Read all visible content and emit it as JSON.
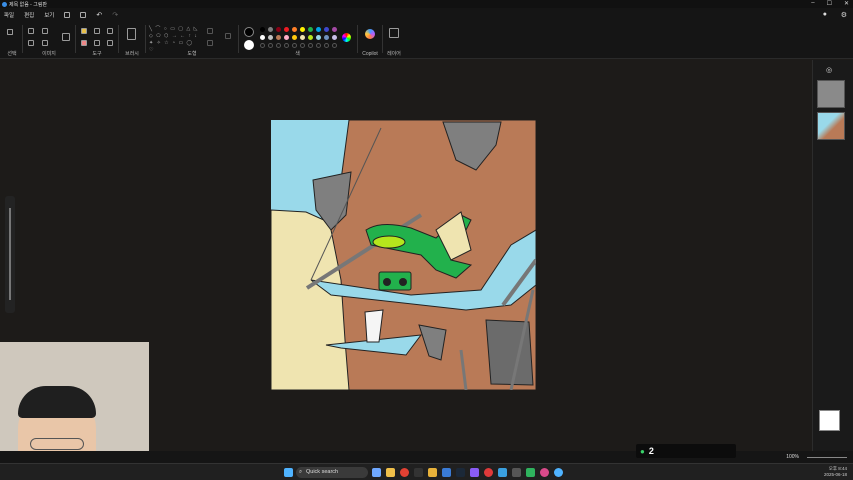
{
  "window": {
    "title": "제목 없음 - 그림판"
  },
  "menu": {
    "items": [
      "파일",
      "편집",
      "보기"
    ]
  },
  "ribbon": {
    "groups": {
      "selection": "선택",
      "image": "이미지",
      "tools": "도구",
      "brushes": "브러시",
      "shapes": "도형",
      "colors": "색",
      "copilot": "Copilot",
      "layers": "레이어"
    },
    "palette": [
      "#000000",
      "#7f7f7f",
      "#880015",
      "#ed1c24",
      "#ff7f27",
      "#fff200",
      "#22b14c",
      "#00a2e8",
      "#3f48cc",
      "#a349a4",
      "#ffffff",
      "#c3c3c3",
      "#b97a57",
      "#ffaec9",
      "#ffc90e",
      "#efe4b0",
      "#b5e61d",
      "#99d9ea",
      "#7092be",
      "#c8bfe7"
    ]
  },
  "status": {
    "zoom": "100%"
  },
  "viewers": {
    "count": "2"
  },
  "taskbar": {
    "search_placeholder": "Quick search"
  },
  "tray": {
    "time": "오후 8:44",
    "date": "2025-06-18"
  },
  "colors": {
    "sky": "#99d9ea",
    "cliff": "#b97a57",
    "sand": "#efe4b0",
    "rock": "#7f7f7f",
    "frog": "#22b14c",
    "frog_light": "#b5e61d",
    "hammock": "#99d9ea"
  }
}
